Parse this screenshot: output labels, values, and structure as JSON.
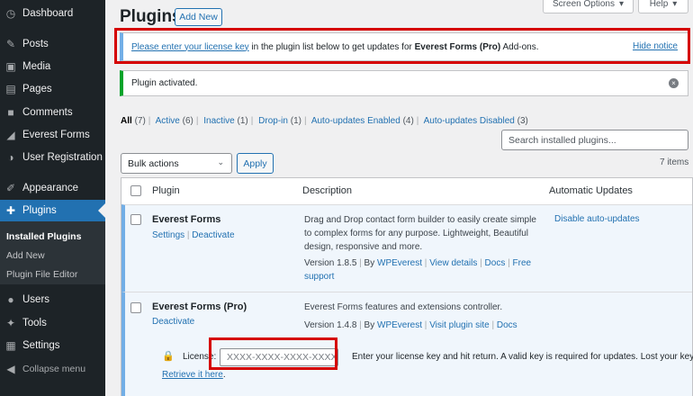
{
  "sidebar": {
    "items": [
      {
        "name": "dashboard",
        "icon": "dashboard-icon",
        "glyph": "◷",
        "label": "Dashboard"
      },
      {
        "name": "posts",
        "icon": "pin-icon",
        "glyph": "✎",
        "label": "Posts"
      },
      {
        "name": "media",
        "icon": "media-icon",
        "glyph": "▣",
        "label": "Media"
      },
      {
        "name": "pages",
        "icon": "page-icon",
        "glyph": "▤",
        "label": "Pages"
      },
      {
        "name": "comments",
        "icon": "comment-icon",
        "glyph": "■",
        "label": "Comments"
      },
      {
        "name": "everest-forms",
        "icon": "everest-forms-icon",
        "glyph": "◢",
        "label": "Everest Forms"
      },
      {
        "name": "user-registration",
        "icon": "user-registration-icon",
        "glyph": "◑",
        "label": "User Registration"
      },
      {
        "name": "appearance",
        "icon": "brush-icon",
        "glyph": "✐",
        "label": "Appearance"
      },
      {
        "name": "plugins",
        "icon": "plugin-icon",
        "glyph": "✚",
        "label": "Plugins"
      },
      {
        "name": "users",
        "icon": "users-icon",
        "glyph": "●",
        "label": "Users"
      },
      {
        "name": "tools",
        "icon": "wrench-icon",
        "glyph": "✦",
        "label": "Tools"
      },
      {
        "name": "settings",
        "icon": "settings-icon",
        "glyph": "▦",
        "label": "Settings"
      }
    ],
    "submenu": [
      "Installed Plugins",
      "Add New",
      "Plugin File Editor"
    ],
    "collapse": {
      "glyph": "◀",
      "label": "Collapse menu"
    }
  },
  "header": {
    "title": "Plugins",
    "add_new": "Add New",
    "screen_options": "Screen Options",
    "help": "Help",
    "caret": "▾"
  },
  "notice": {
    "link": "Please enter your license key",
    "text1": " in the plugin list below to get updates for ",
    "bold": "Everest Forms (Pro)",
    "text2": " Add-ons.",
    "hide": "Hide notice"
  },
  "activated": {
    "text": "Plugin activated.",
    "dismiss_glyph": "×"
  },
  "filters": [
    {
      "label": "All",
      "count": "(7)"
    },
    {
      "label": "Active",
      "count": "(6)"
    },
    {
      "label": "Inactive",
      "count": "(1)"
    },
    {
      "label": "Drop-in",
      "count": "(1)"
    },
    {
      "label": "Auto-updates Enabled",
      "count": "(4)"
    },
    {
      "label": "Auto-updates Disabled",
      "count": "(3)"
    }
  ],
  "search": {
    "placeholder": "Search installed plugins..."
  },
  "bulk": {
    "label": "Bulk actions",
    "chev": "⌄",
    "apply": "Apply"
  },
  "items_count": "7 items",
  "table": {
    "columns": [
      "Plugin",
      "Description",
      "Automatic Updates"
    ],
    "rows": [
      {
        "name": "Everest Forms",
        "actions": [
          "Settings",
          "Deactivate"
        ],
        "desc": [
          "Drag and Drop contact form builder to easily create simple",
          "to complex forms for any purpose. Lightweight, Beautiful",
          "design, responsive and more."
        ],
        "version": "Version 1.8.5",
        "by": "By",
        "author": "WPEverest",
        "links": [
          "View details",
          "Docs",
          "Free"
        ],
        "wrap": "support",
        "auto": "Disable auto-updates"
      },
      {
        "name": "Everest Forms (Pro)",
        "actions": [
          "Deactivate"
        ],
        "desc": [
          "Everest Forms features and extensions controller."
        ],
        "version": "Version 1.4.8",
        "by": "By",
        "author": "WPEverest",
        "links": [
          "Visit plugin site",
          "Docs"
        ]
      }
    ],
    "license": {
      "label": "License:",
      "placeholder": "XXXX-XXXX-XXXX-XXXX",
      "help": "Enter your license key and hit return. A valid key is required for updates. Lost your key?",
      "retrieve": "Retrieve it here",
      "dot": ".",
      "lock": "🔒"
    }
  },
  "colors": {
    "accent": "#2271b1",
    "highlight": "#d50000",
    "success": "#00a32a",
    "sidebar": "#1d2327"
  }
}
